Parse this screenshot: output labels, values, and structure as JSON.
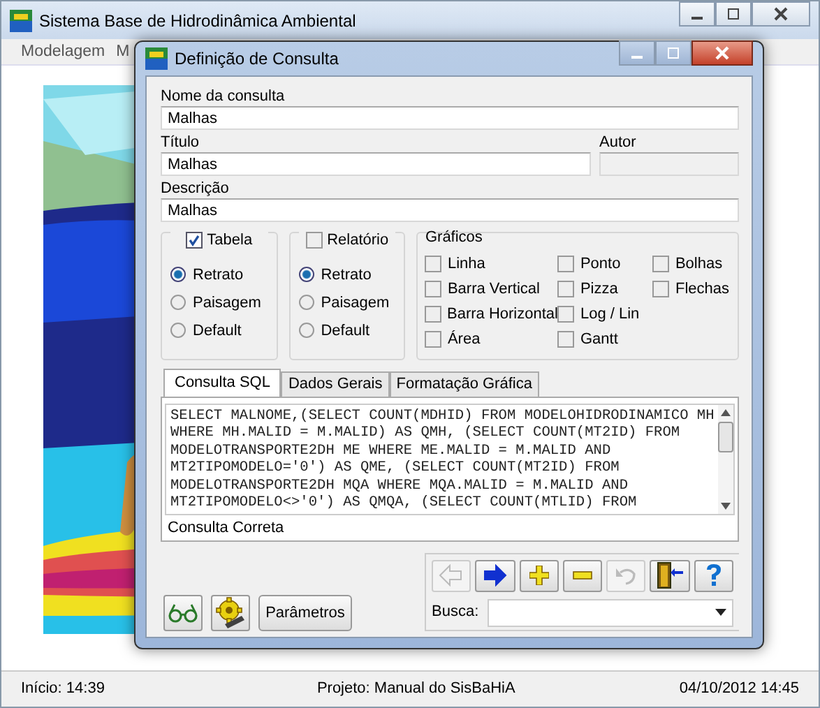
{
  "window": {
    "title": "Sistema Base de Hidrodinâmica Ambiental"
  },
  "menu": [
    "Modelagem",
    "M"
  ],
  "background": {
    "kind": "picture"
  },
  "dialog": {
    "title": "Definição de Consulta",
    "fields": [
      {
        "label": "Nome da consulta",
        "value": "Malhas"
      },
      {
        "label": "Título",
        "value": "Malhas"
      },
      {
        "label": "Autor",
        "disabled": true
      },
      {
        "label": "Descrição",
        "value": "Malhas"
      }
    ],
    "output_groups": [
      {
        "label": "Tabela",
        "checked": true,
        "options": [
          {
            "label": "Retrato",
            "selected": true
          },
          {
            "label": "Paisagem",
            "selected": false
          },
          {
            "label": "Default",
            "selected": false
          }
        ]
      },
      {
        "label": "Relatório",
        "checked": false,
        "options": [
          {
            "label": "Retrato",
            "selected": true
          },
          {
            "label": "Paisagem",
            "selected": false
          },
          {
            "label": "Default",
            "selected": false
          }
        ]
      }
    ],
    "graficos": {
      "label": "Gráficos",
      "columns": [
        [
          {
            "label": "Linha",
            "checked": false
          },
          {
            "label": "Barra Vertical",
            "checked": false
          },
          {
            "label": "Barra Horizontal",
            "checked": false
          },
          {
            "label": "Área",
            "checked": false
          }
        ],
        [
          {
            "label": "Ponto",
            "checked": false
          },
          {
            "label": "Pizza",
            "checked": false
          },
          {
            "label": "Log / Lin",
            "checked": false
          },
          {
            "label": "Gantt",
            "checked": false
          }
        ],
        [
          {
            "label": "Bolhas",
            "checked": false
          },
          {
            "label": "Flechas",
            "checked": false
          }
        ]
      ]
    },
    "tabs": [
      {
        "label": "Consulta SQL",
        "selected": true
      },
      {
        "label": "Dados Gerais",
        "selected": false
      },
      {
        "label": "Formatação Gráfica",
        "selected": false
      }
    ],
    "sql_lines": [
      "SELECT MALNOME,(SELECT COUNT(MDHID) FROM MODELOHIDRODINAMICO MH",
      "WHERE MH.MALID = M.MALID) AS QMH, (SELECT COUNT(MT2ID) FROM",
      "MODELOTRANSPORTE2DH ME WHERE ME.MALID = M.MALID AND",
      "MT2TIPOMODELO='0') AS QME, (SELECT COUNT(MT2ID) FROM",
      "MODELOTRANSPORTE2DH MQA WHERE MQA.MALID = M.MALID AND",
      "MT2TIPOMODELO<>'0') AS QMQA, (SELECT COUNT(MTLID) FROM"
    ],
    "query_status": "Consulta Correta",
    "nav_buttons": [
      {
        "kind": "back",
        "disabled": true
      },
      {
        "kind": "forward",
        "disabled": false
      },
      {
        "kind": "add",
        "disabled": false
      },
      {
        "kind": "remove",
        "disabled": false
      },
      {
        "kind": "undo",
        "disabled": true
      },
      {
        "kind": "exit",
        "disabled": false
      },
      {
        "kind": "help",
        "disabled": false
      }
    ],
    "search": {
      "label": "Busca:"
    },
    "parameters_button": "Parâmetros"
  },
  "status_bar": [
    "Início: 14:39",
    "Projeto: Manual do SisBaHiA",
    "04/10/2012 14:45"
  ]
}
